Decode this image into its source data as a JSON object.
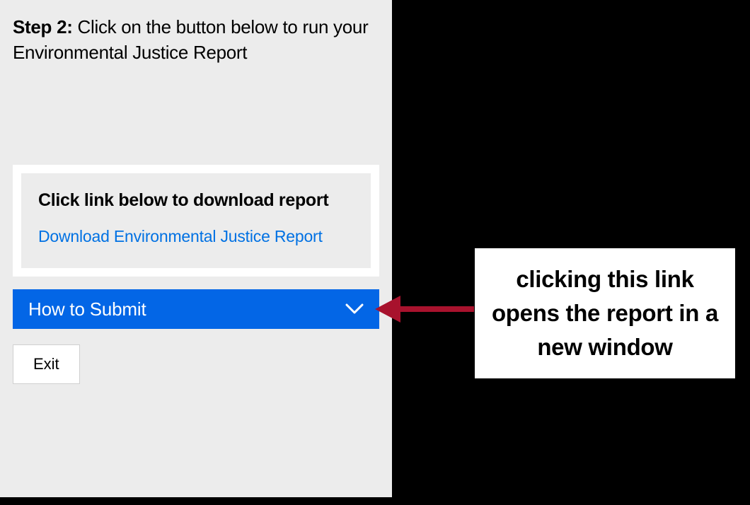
{
  "step": {
    "label": "Step 2:",
    "text": " Click on the button below to run your Environmental Justice Report"
  },
  "download": {
    "heading": "Click link below to download report",
    "link_text": "Download Environmental Justice Report"
  },
  "accordion": {
    "label": "How to Submit"
  },
  "exit": {
    "label": "Exit"
  },
  "annotation": {
    "text": "clicking this link opens the report in a new window"
  },
  "colors": {
    "accent": "#0366E6",
    "link": "#0071e3",
    "arrow": "#a8122d"
  }
}
